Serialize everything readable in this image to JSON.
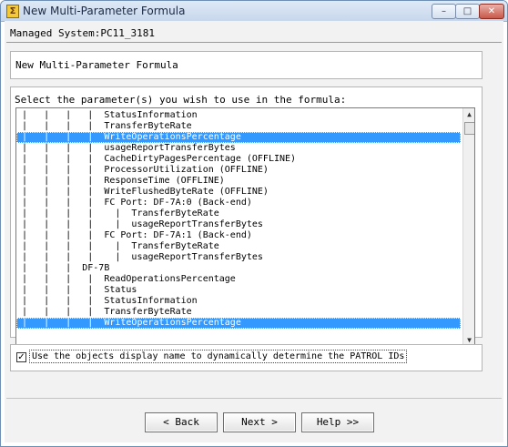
{
  "window": {
    "title": "New Multi-Parameter Formula",
    "title_icon": "app-icon",
    "controls": {
      "minimize": "–",
      "maximize": "□",
      "close": "✕"
    }
  },
  "managed_system_label": "Managed System:PC11_3181",
  "formula_heading": "New Multi-Parameter Formula",
  "params_prompt": "Select the parameter(s) you wish to use in the formula:",
  "parameter_list": [
    {
      "text": " |   |   |   |  StatusInformation",
      "selected": false
    },
    {
      "text": " |   |   |   |  TransferByteRate",
      "selected": false
    },
    {
      "text": " |   |   |   |  WriteOperationsPercentage",
      "selected": true
    },
    {
      "text": " |   |   |   |  usageReportTransferBytes",
      "selected": false
    },
    {
      "text": " |   |   |   |  CacheDirtyPagesPercentage (OFFLINE)",
      "selected": false
    },
    {
      "text": " |   |   |   |  ProcessorUtilization (OFFLINE)",
      "selected": false
    },
    {
      "text": " |   |   |   |  ResponseTime (OFFLINE)",
      "selected": false
    },
    {
      "text": " |   |   |   |  WriteFlushedByteRate (OFFLINE)",
      "selected": false
    },
    {
      "text": " |   |   |   |  FC Port: DF-7A:0 (Back-end)",
      "selected": false
    },
    {
      "text": " |   |   |   |    |  TransferByteRate",
      "selected": false
    },
    {
      "text": " |   |   |   |    |  usageReportTransferBytes",
      "selected": false
    },
    {
      "text": " |   |   |   |  FC Port: DF-7A:1 (Back-end)",
      "selected": false
    },
    {
      "text": " |   |   |   |    |  TransferByteRate",
      "selected": false
    },
    {
      "text": " |   |   |   |    |  usageReportTransferBytes",
      "selected": false
    },
    {
      "text": " |   |   |  DF-7B",
      "selected": false
    },
    {
      "text": " |   |   |   |  ReadOperationsPercentage",
      "selected": false
    },
    {
      "text": " |   |   |   |  Status",
      "selected": false
    },
    {
      "text": " |   |   |   |  StatusInformation",
      "selected": false
    },
    {
      "text": " |   |   |   |  TransferByteRate",
      "selected": false
    },
    {
      "text": " |   |   |   |  WriteOperationsPercentage",
      "selected": true
    }
  ],
  "scrollbar": {
    "up_arrow": "▲",
    "down_arrow": "▼"
  },
  "display_name_checkbox": {
    "checked": true,
    "mark": "✓",
    "label": "Use the objects display name to dynamically determine the PATROL IDs"
  },
  "buttons": {
    "back": "< Back",
    "next": "Next >",
    "help": "Help >>"
  }
}
